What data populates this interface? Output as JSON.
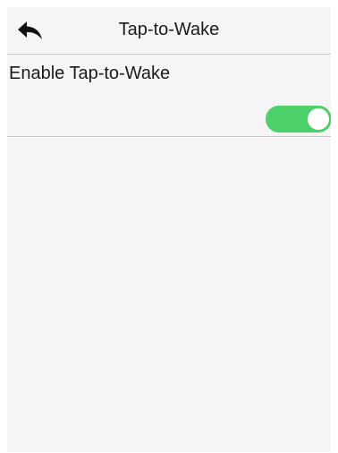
{
  "header": {
    "title": "Tap-to-Wake",
    "back_icon": "back-arrow-icon"
  },
  "setting": {
    "label": "Enable Tap-to-Wake",
    "enabled": true,
    "toggle_color": "#4cd06a"
  }
}
